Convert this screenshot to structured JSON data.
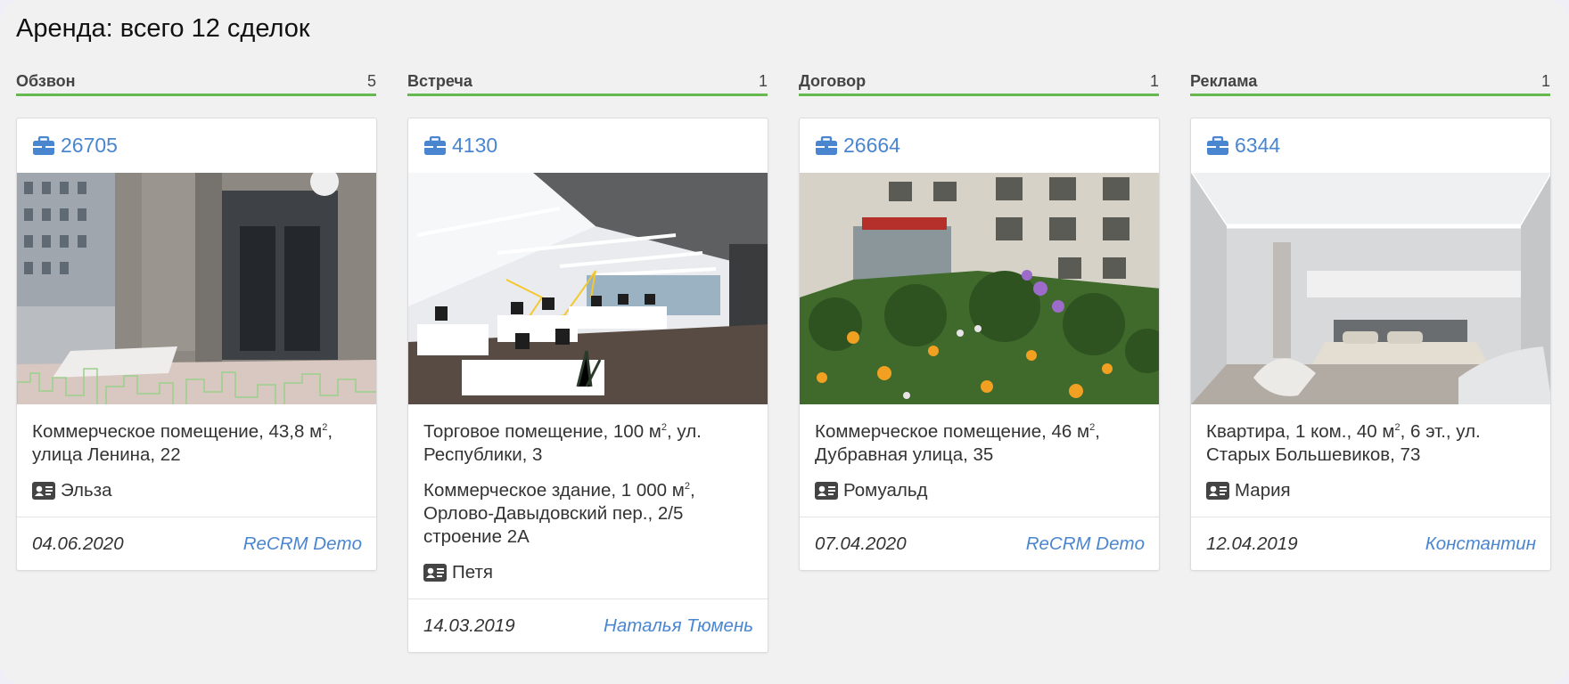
{
  "page": {
    "title": "Аренда: всего 12 сделок"
  },
  "colors": {
    "accent_green": "#66b94e",
    "link_blue": "#4a86d0"
  },
  "columns": [
    {
      "name": "Обзвон",
      "count": "5",
      "card": {
        "id": "26705",
        "icon": "briefcase-icon",
        "photo": "building-facade-photo",
        "descriptions": [
          {
            "pre": "Коммерческое помещение, 43,8 м",
            "sup": "2",
            "post": ", улица Ленина, 22"
          }
        ],
        "agent": "Эльза",
        "date": "04.06.2020",
        "owner": "ReCRM Demo"
      }
    },
    {
      "name": "Встреча",
      "count": "1",
      "card": {
        "id": "4130",
        "icon": "briefcase-icon",
        "photo": "office-interior-photo",
        "descriptions": [
          {
            "pre": "Торговое помещение, 100 м",
            "sup": "2",
            "post": ", ул. Республики, 3"
          },
          {
            "pre": "Коммерческое здание, 1 000 м",
            "sup": "2",
            "post": ", Орлово-Давыдовский пер., 2/5 строение 2А"
          }
        ],
        "agent": "Петя",
        "date": "14.03.2019",
        "owner": "Наталья Тюмень"
      }
    },
    {
      "name": "Договор",
      "count": "1",
      "card": {
        "id": "26664",
        "icon": "briefcase-icon",
        "photo": "street-flowers-photo",
        "descriptions": [
          {
            "pre": "Коммерческое помещение, 46 м",
            "sup": "2",
            "post": ", Дубравная улица, 35"
          }
        ],
        "agent": "Ромуальд",
        "date": "07.04.2020",
        "owner": "ReCRM Demo"
      }
    },
    {
      "name": "Реклама",
      "count": "1",
      "card": {
        "id": "6344",
        "icon": "briefcase-icon",
        "photo": "bedroom-interior-photo",
        "descriptions": [
          {
            "pre": "Квартира, 1 ком., 40 м",
            "sup": "2",
            "post": ", 6 эт., ул. Старых Большевиков, 73"
          }
        ],
        "agent": "Мария",
        "date": "12.04.2019",
        "owner": "Константин"
      }
    }
  ]
}
